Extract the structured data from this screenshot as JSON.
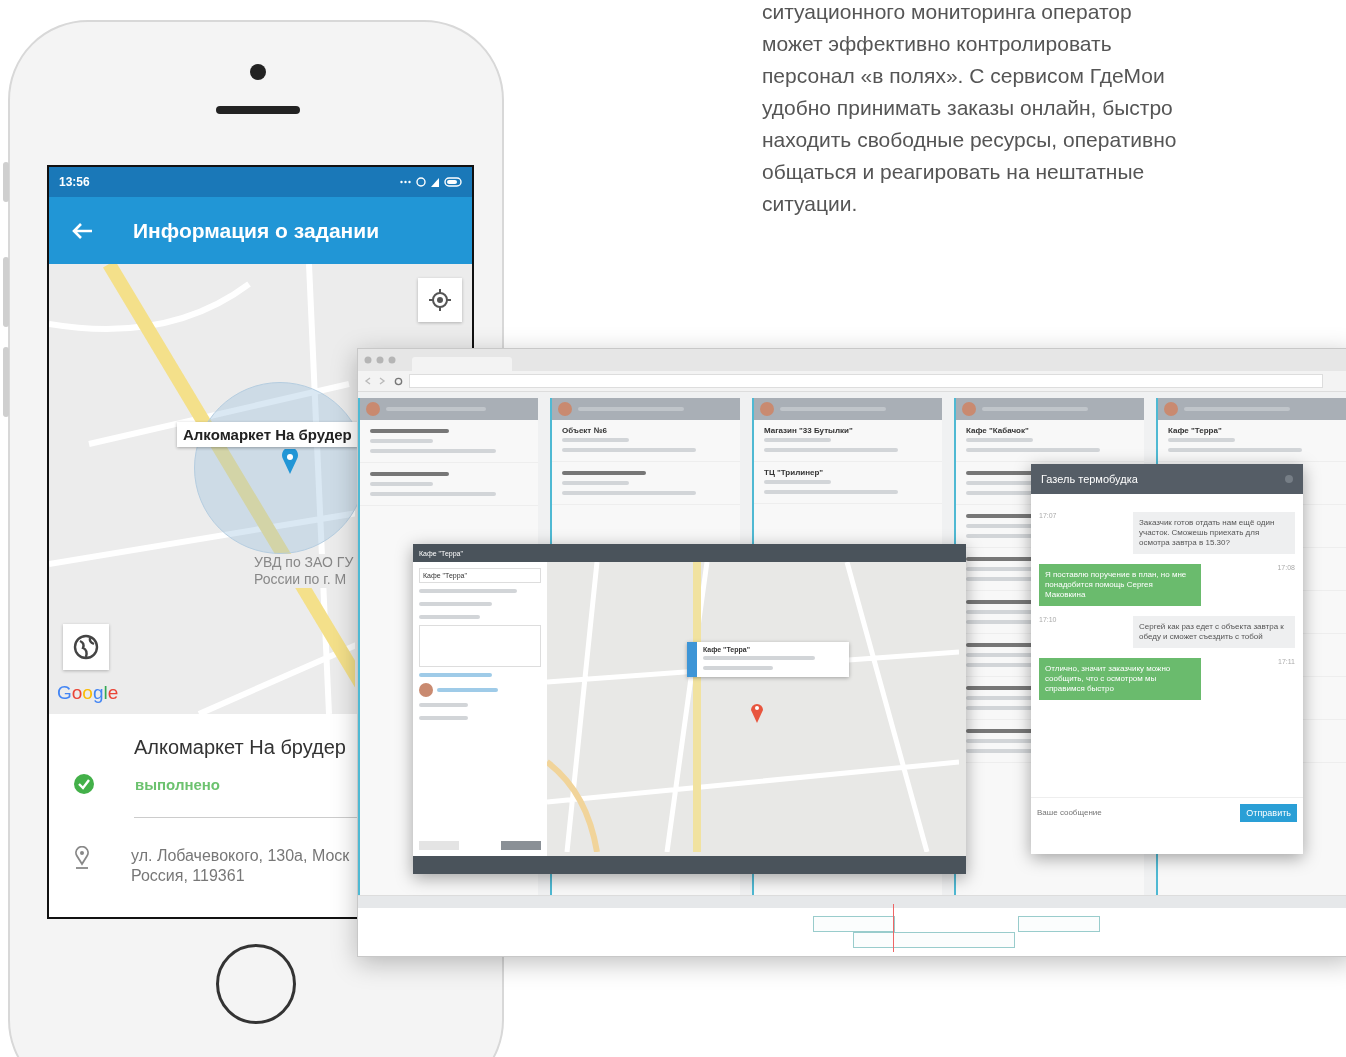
{
  "intro_text": "ситуационного мониторинга оператор может эффективно контролировать персонал «в полях». С сервисом ГдеМои удобно принимать заказы онлайн, быстро находить свободные ресурсы, оперативно общаться и реагировать на нештатные ситуации.",
  "phone": {
    "status_time": "13:56",
    "title": "Информация о задании",
    "map": {
      "marker_label": "Алкомаркет На брудер",
      "poi_label": [
        "УВД по ЗАО ГУ",
        "России по г. М"
      ],
      "logo": "Google"
    },
    "task": {
      "name": "Алкомаркет На брудер",
      "status": "выполнено",
      "done": true,
      "address": [
        "ул. Лобачевокого, 130а, Моск",
        "Россия, 119361"
      ]
    }
  },
  "browser": {
    "columns": [
      {
        "cards": [
          {
            "kind": "blurred"
          },
          {
            "kind": "blurred"
          }
        ]
      },
      {
        "cards": [
          {
            "kind": "titled",
            "title": "Объект №6"
          },
          {
            "kind": "blurred"
          }
        ]
      },
      {
        "cards": [
          {
            "kind": "titled",
            "title": "Магазин \"33 Бутылки\""
          },
          {
            "kind": "titled",
            "title": "ТЦ \"Трилинер\""
          }
        ]
      },
      {
        "cards": [
          {
            "kind": "titled",
            "title": "Кафе \"Кабачок\""
          },
          {
            "kind": "blurred"
          },
          {
            "kind": "blurred"
          },
          {
            "kind": "blurred"
          },
          {
            "kind": "blurred"
          },
          {
            "kind": "blurred"
          },
          {
            "kind": "blurred"
          },
          {
            "kind": "blurred"
          }
        ]
      },
      {
        "cards": [
          {
            "kind": "titled",
            "title": "Кафе \"Терра\""
          },
          {
            "kind": "blurred"
          },
          {
            "kind": "blurred"
          },
          {
            "kind": "blurred"
          },
          {
            "kind": "blurred"
          },
          {
            "kind": "blurred"
          },
          {
            "kind": "blurred"
          },
          {
            "kind": "blurred"
          }
        ]
      }
    ],
    "task_window": {
      "title": "Кафе \"Терра\"",
      "name_value": "Кафе \"Терра\"",
      "popup_title": "Кафе \"Терра\""
    },
    "chat": {
      "title": "Газель термобудка",
      "messages": [
        {
          "own": false,
          "time": "17:07",
          "text": "Заказчик готов отдать нам ещё один участок. Сможешь приехать для осмотра завтра в 15.30?"
        },
        {
          "own": true,
          "time": "17:08",
          "text": "Я поставлю поручение в план, но мне понадобится помощь Сергея Маковкина"
        },
        {
          "own": false,
          "time": "17:10",
          "text": "Сергей как раз едет с объекта завтра к обеду и сможет съездить с тобой"
        },
        {
          "own": true,
          "time": "17:11",
          "text": "Отлично, значит заказчику можно сообщить, что с осмотром мы справимся быстро"
        }
      ],
      "placeholder": "Ваше сообщение",
      "send_label": "Отправить"
    }
  }
}
